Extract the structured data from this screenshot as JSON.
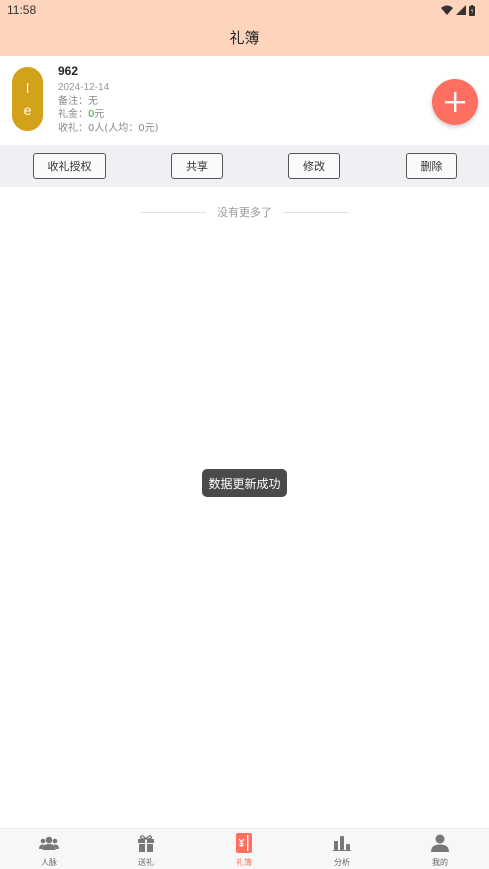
{
  "status": {
    "time": "11:58"
  },
  "header": {
    "title": "礼簿"
  },
  "record": {
    "avatar_top": "l",
    "avatar_bottom": "e",
    "name": "962",
    "date": "2024-12-14",
    "remark_label": "备注：",
    "remark_value": "无",
    "gift_label": "礼金：",
    "gift_amount": "0",
    "gift_unit": "元",
    "received_text_a": "收礼：0人(人均：",
    "received_avg": "0元",
    "received_text_b": ")"
  },
  "actions": {
    "authorize": "收礼授权",
    "share": "共享",
    "edit": "修改",
    "delete": "删除"
  },
  "list": {
    "no_more": "没有更多了"
  },
  "toast": {
    "message": "数据更新成功"
  },
  "tabs": [
    {
      "label": "人脉",
      "icon": "people-icon"
    },
    {
      "label": "送礼",
      "icon": "gift-icon"
    },
    {
      "label": "礼簿",
      "icon": "ledger-icon",
      "active": true
    },
    {
      "label": "分析",
      "icon": "chart-icon"
    },
    {
      "label": "我的",
      "icon": "user-icon"
    }
  ],
  "colors": {
    "header_bg": "#ffd4bd",
    "accent": "#ff6f61",
    "avatar_bg": "#d3a21b",
    "money": "#25b43e"
  }
}
